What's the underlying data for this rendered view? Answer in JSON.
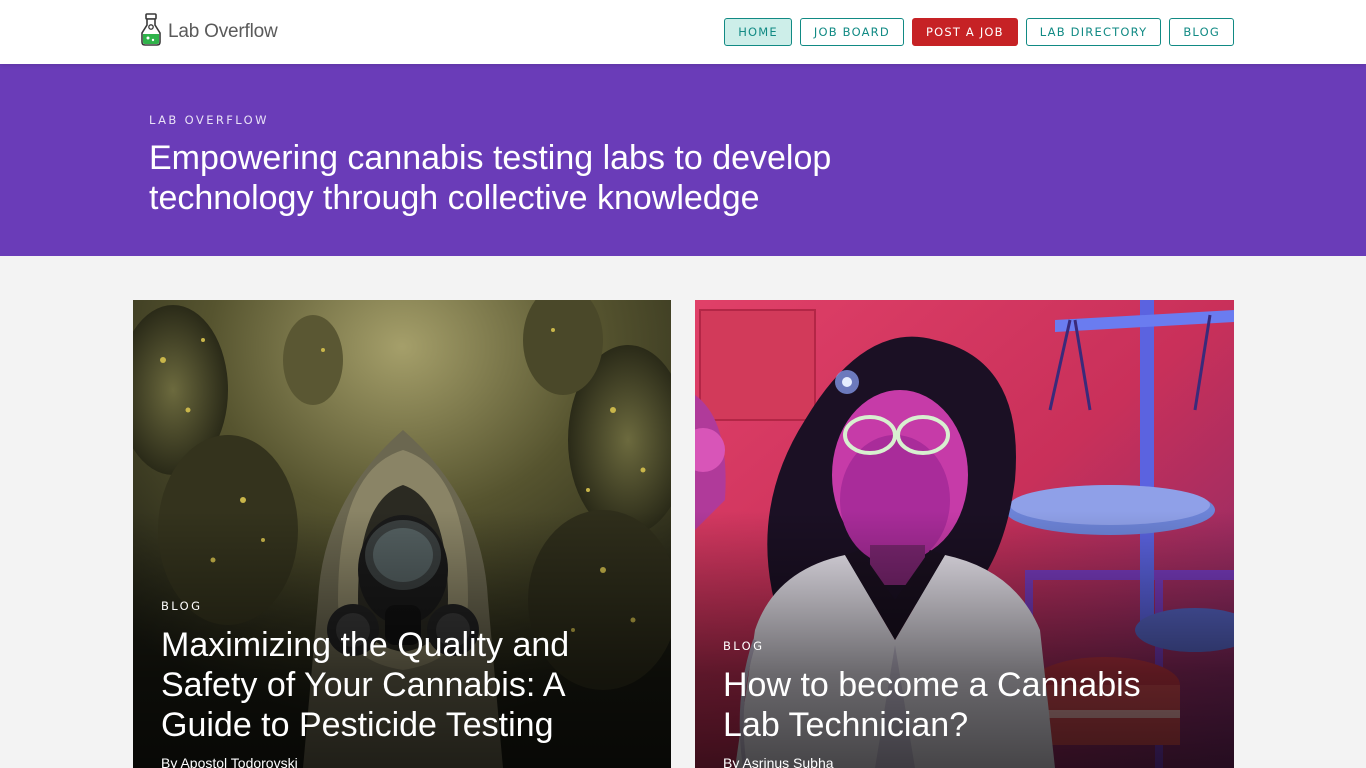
{
  "header": {
    "logo_text": "Lab Overflow",
    "nav": [
      {
        "label": "HOME"
      },
      {
        "label": "JOB BOARD"
      },
      {
        "label": "POST A JOB"
      },
      {
        "label": "LAB DIRECTORY"
      },
      {
        "label": "BLOG"
      }
    ],
    "active": "HOME",
    "colors": {
      "accent": "#118a84",
      "post": "#c62225",
      "active_bg": "#cdeee9"
    }
  },
  "hero": {
    "kicker": "LAB OVERFLOW",
    "title": "Empowering cannabis testing labs to develop technology through collective knowledge",
    "background": "#6a3cb8"
  },
  "posts": [
    {
      "category": "BLOG",
      "title": "Maximizing the Quality and Safety of Your Cannabis: A Guide to Pesticide Testing",
      "author": "By Apostol Todorovski",
      "image": "gas-mask-figure-in-cannabis-field"
    },
    {
      "category": "BLOG",
      "title": "How to become a Cannabis Lab Technician?",
      "author": "By Asrinus Subha",
      "image": "lab-technician-with-scale-illustration"
    }
  ]
}
